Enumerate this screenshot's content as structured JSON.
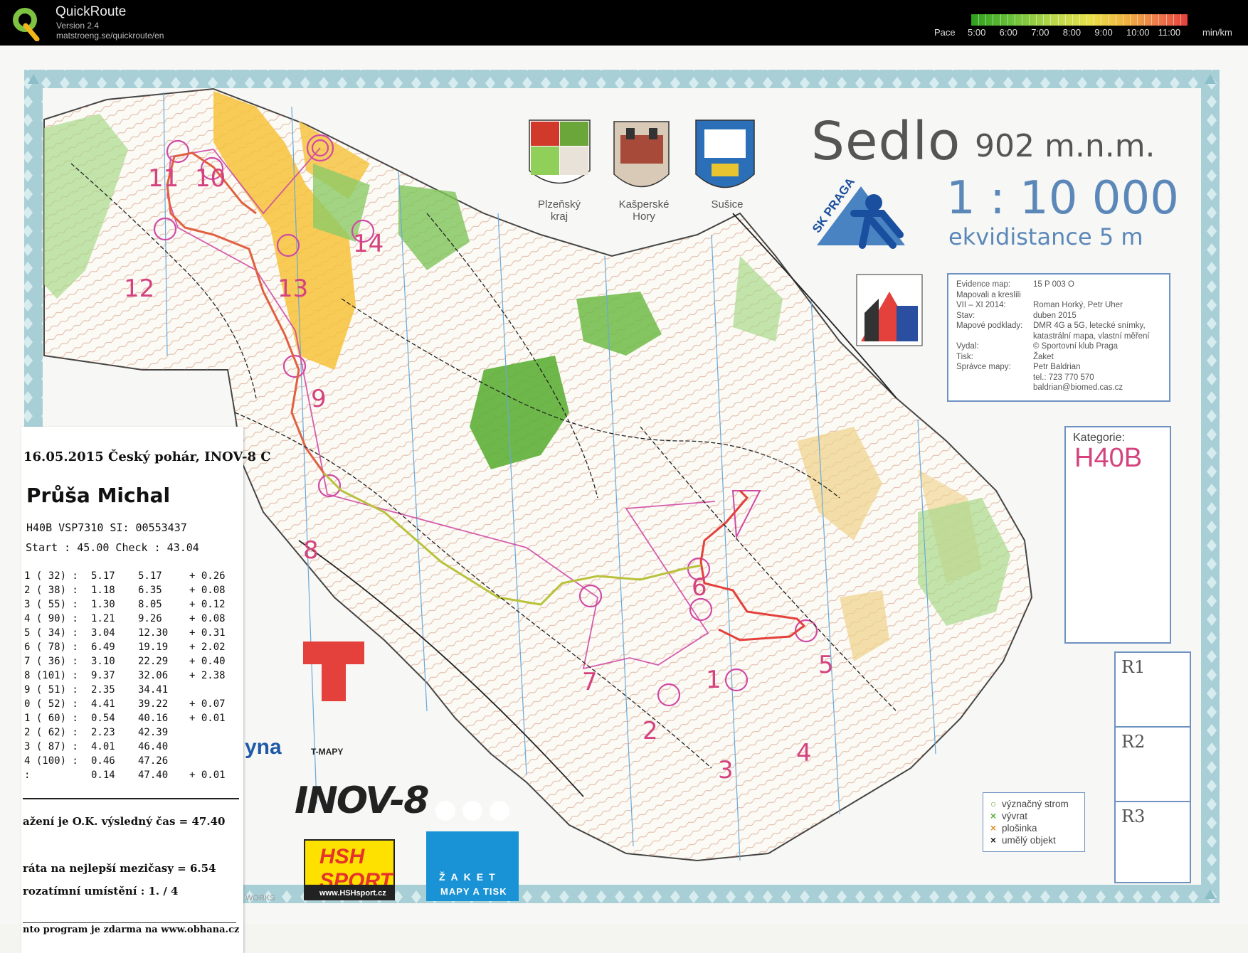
{
  "app": {
    "title": "QuickRoute",
    "version": "Version 2.4",
    "url": "matstroeng.se/quickroute/en",
    "logo_letter": "Q"
  },
  "pace_scale": {
    "label": "Pace",
    "ticks": [
      "5:00",
      "6:00",
      "7:00",
      "8:00",
      "9:00",
      "10:00",
      "11:00"
    ],
    "unit": "min/km"
  },
  "map": {
    "title": "Sedlo",
    "altitude": "902 m.n.m.",
    "scale": "1 : 10 000",
    "contour": "ekvidistance 5 m",
    "club_logo": "SK PRAGA",
    "coats": [
      {
        "label_1": "Plzeňský",
        "label_2": "kraj"
      },
      {
        "label_1": "Kašperské",
        "label_2": "Hory"
      },
      {
        "label_1": "Sušice",
        "label_2": ""
      }
    ],
    "info": [
      {
        "key": "Evidence map:",
        "value": "15 P 003 O"
      },
      {
        "key": "Mapovali a kreslili",
        "value": ""
      },
      {
        "key": "VII – XI 2014:",
        "value": "Roman Horký, Petr Uher"
      },
      {
        "key": "Stav:",
        "value": "duben 2015"
      },
      {
        "key": "Mapové podklady:",
        "value": "DMR 4G a 5G, letecké snímky,"
      },
      {
        "key": "",
        "value": "katastrální mapa, vlastní měření"
      },
      {
        "key": "Vydal:",
        "value": "© Sportovní klub Praga"
      },
      {
        "key": "Tisk:",
        "value": "Žaket"
      },
      {
        "key": "Správce mapy:",
        "value": "Petr Baldrian"
      },
      {
        "key": "",
        "value": "tel.: 723 770 570"
      },
      {
        "key": "",
        "value": "baldrian@biomed.cas.cz"
      }
    ],
    "category_label": "Kategorie:",
    "category_value": "H40B",
    "r_boxes": [
      "R1",
      "R2",
      "R3"
    ],
    "legend": [
      {
        "symbol": "○",
        "color": "#5ab03a",
        "label": "význačný strom"
      },
      {
        "symbol": "×",
        "color": "#5ab03a",
        "label": "vývrat"
      },
      {
        "symbol": "×",
        "color": "#e0902a",
        "label": "plošinka"
      },
      {
        "symbol": "×",
        "color": "#222222",
        "label": "umělý objekt"
      }
    ],
    "sponsors": {
      "tmapy": "T-MAPY",
      "inov": "INOV-8",
      "hsh": "HSH SPORT",
      "hsh_url": "www.HSHsport.cz",
      "zaket_1": "ŽAKET",
      "zaket_2": "MAPY A TISK",
      "works": "WORKS",
      "yna": "yna"
    },
    "controls": [
      "1",
      "2",
      "3",
      "4",
      "5",
      "6",
      "7",
      "8",
      "9",
      "10",
      "11",
      "12",
      "13",
      "14"
    ]
  },
  "slip": {
    "header": "16.05.2015 Český pohár, INOV-8 C",
    "name": "Průša Michal",
    "meta": "H40B  VSP7310  SI: 00553437",
    "start_check": "Start : 45.00    Check : 43.04",
    "splits": [
      {
        "ctrl": "1 ( 32) :",
        "split": "5.17",
        "total": "5.17",
        "loss": "+ 0.26"
      },
      {
        "ctrl": "2 ( 38) :",
        "split": "1.18",
        "total": "6.35",
        "loss": "+ 0.08"
      },
      {
        "ctrl": "3 ( 55) :",
        "split": "1.30",
        "total": "8.05",
        "loss": "+ 0.12"
      },
      {
        "ctrl": "4 ( 90) :",
        "split": "1.21",
        "total": "9.26",
        "loss": "+ 0.08"
      },
      {
        "ctrl": "5 ( 34) :",
        "split": "3.04",
        "total": "12.30",
        "loss": "+ 0.31"
      },
      {
        "ctrl": "6 ( 78) :",
        "split": "6.49",
        "total": "19.19",
        "loss": "+ 2.02"
      },
      {
        "ctrl": "7 ( 36) :",
        "split": "3.10",
        "total": "22.29",
        "loss": "+ 0.40"
      },
      {
        "ctrl": "8 (101) :",
        "split": "9.37",
        "total": "32.06",
        "loss": "+ 2.38"
      },
      {
        "ctrl": "9 ( 51) :",
        "split": "2.35",
        "total": "34.41",
        "loss": ""
      },
      {
        "ctrl": "0 ( 52) :",
        "split": "4.41",
        "total": "39.22",
        "loss": "+ 0.07"
      },
      {
        "ctrl": "1 ( 60) :",
        "split": "0.54",
        "total": "40.16",
        "loss": "+ 0.01"
      },
      {
        "ctrl": "2 ( 62) :",
        "split": "2.23",
        "total": "42.39",
        "loss": ""
      },
      {
        "ctrl": "3 ( 87) :",
        "split": "4.01",
        "total": "46.40",
        "loss": ""
      },
      {
        "ctrl": "4 (100) :",
        "split": "0.46",
        "total": "47.26",
        "loss": ""
      },
      {
        "ctrl": "      :",
        "split": "0.14",
        "total": "47.40",
        "loss": "+ 0.01"
      }
    ],
    "result_ok": "ažení je O.K. výsledný čas =  47.40",
    "loss_total": "ráta na nejlepší mezičasy =  6.54",
    "placing": "rozatímní umístění : 1. / 4",
    "footer": "nto program je zdarma na www.obhana.cz"
  }
}
